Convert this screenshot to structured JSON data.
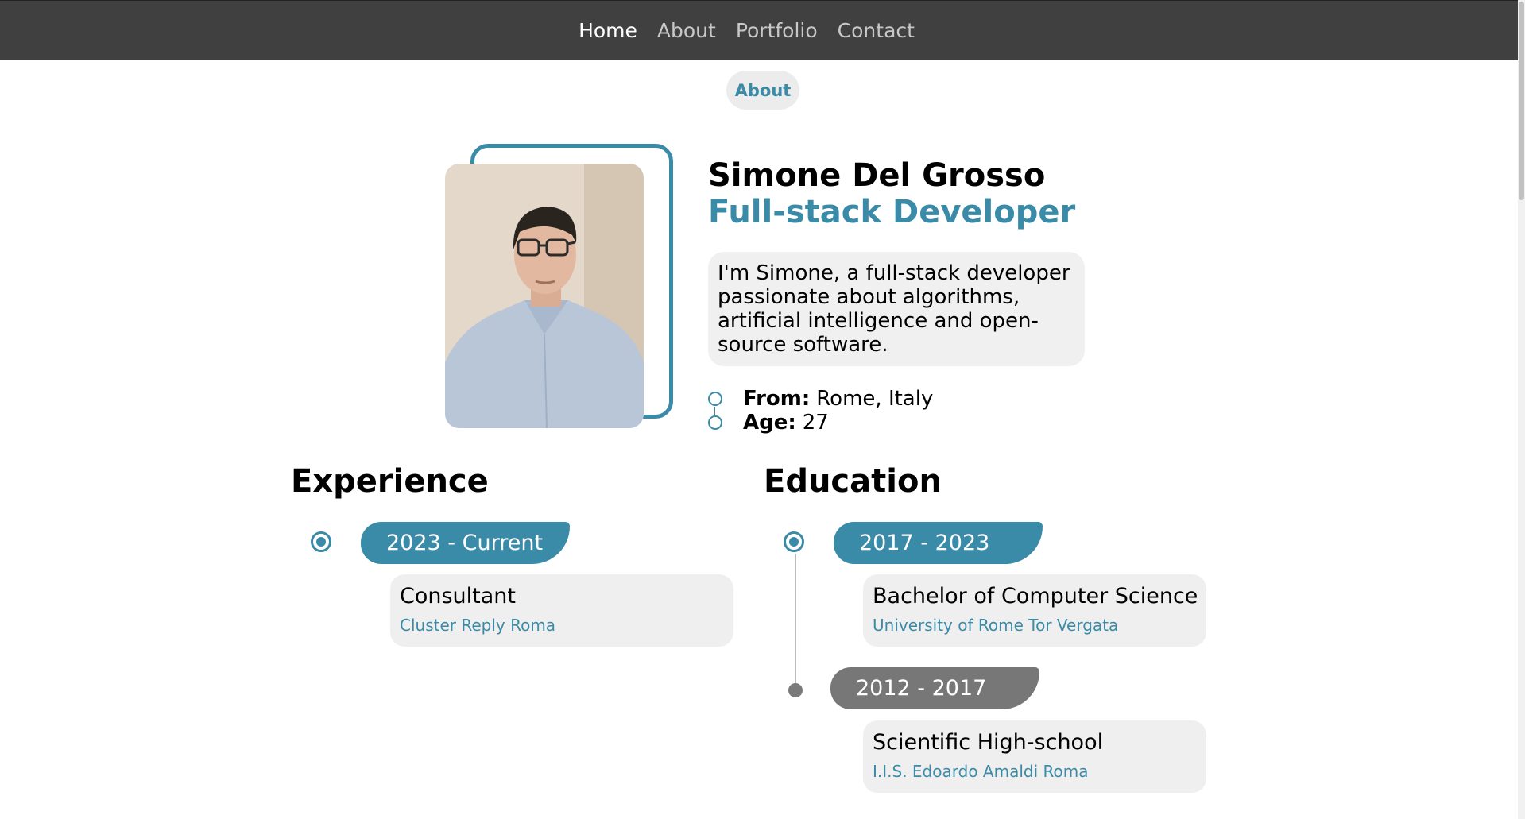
{
  "nav": {
    "items": [
      {
        "label": "Home",
        "active": true
      },
      {
        "label": "About",
        "active": false
      },
      {
        "label": "Portfolio",
        "active": false
      },
      {
        "label": "Contact",
        "active": false
      }
    ]
  },
  "section_label": "About",
  "profile": {
    "name": "Simone Del Grosso",
    "role": "Full-stack Developer",
    "bio": "I'm Simone, a full-stack developer passionate about algorithms, artificial intelligence and open-source software.",
    "facts": [
      {
        "label": "From:",
        "value": "Rome, Italy"
      },
      {
        "label": "Age:",
        "value": "27"
      }
    ]
  },
  "experience": {
    "title": "Experience",
    "entries": [
      {
        "period": "2023 - Current",
        "title": "Consultant",
        "organization": "Cluster Reply Roma",
        "current": true
      }
    ]
  },
  "education": {
    "title": "Education",
    "entries": [
      {
        "period": "2017 - 2023",
        "title": "Bachelor of Computer Science",
        "organization": "University of Rome Tor Vergata",
        "current": true
      },
      {
        "period": "2012 - 2017",
        "title": "Scientific High-school",
        "organization": "I.I.S. Edoardo Amaldi Roma",
        "current": false
      }
    ]
  },
  "colors": {
    "accent": "#3a8ba8",
    "navbar": "#404040",
    "past": "#777777",
    "card": "#efefef"
  }
}
